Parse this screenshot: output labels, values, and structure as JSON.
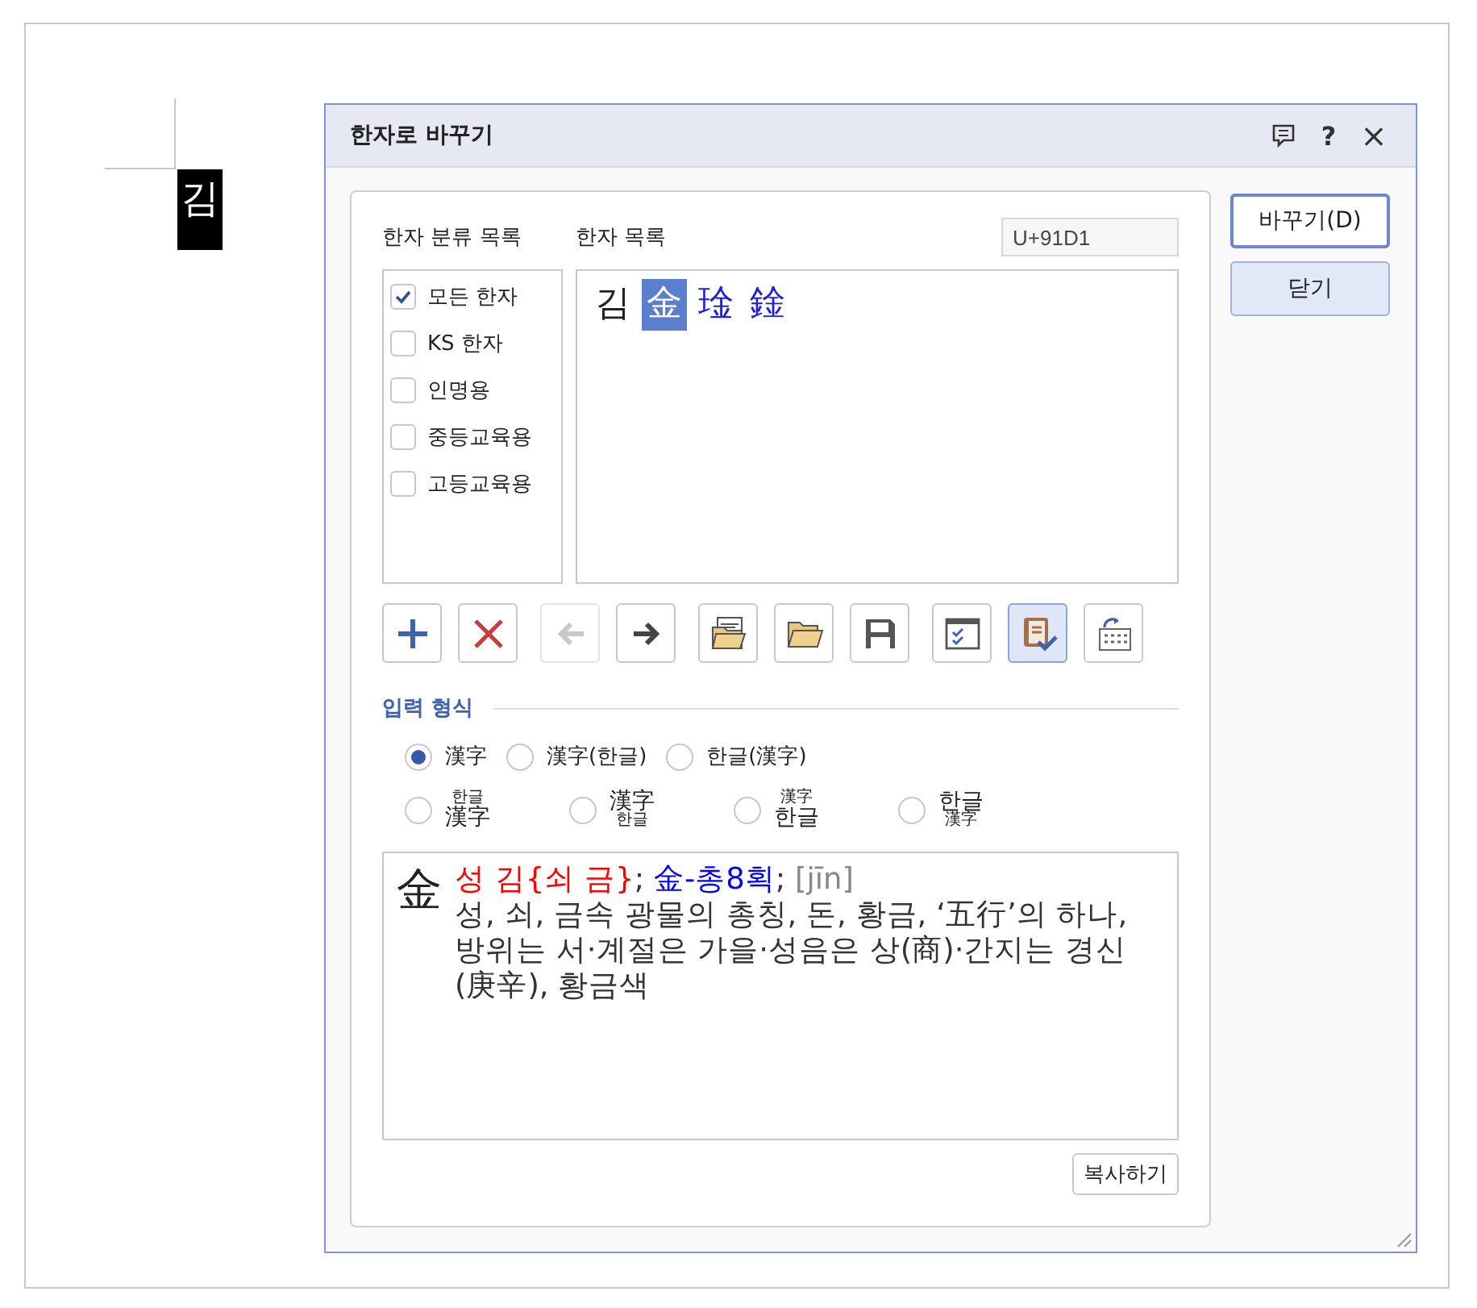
{
  "document": {
    "selected_text": "김"
  },
  "window": {
    "title": "한자로 바꾸기"
  },
  "title_buttons": [
    {
      "kind": "comment"
    },
    {
      "kind": "help",
      "label": "?"
    },
    {
      "kind": "close",
      "label": "×"
    }
  ],
  "category_header": "한자 분류 목록",
  "hanja_header": "한자 목록",
  "code_field": {
    "value": "U+91D1"
  },
  "categories": [
    {
      "label": "모든 한자",
      "checked": true
    },
    {
      "label": "KS 한자",
      "checked": false
    },
    {
      "label": "인명용",
      "checked": false
    },
    {
      "label": "중등교육용",
      "checked": false
    },
    {
      "label": "고등교육용",
      "checked": false
    }
  ],
  "hanja_list": [
    {
      "text": "김",
      "kind": "hangul",
      "selected": false
    },
    {
      "text": "金",
      "kind": "hanja",
      "selected": true
    },
    {
      "text": "琻",
      "kind": "hanja",
      "selected": false
    },
    {
      "text": "鍂",
      "kind": "hanja",
      "selected": false
    }
  ],
  "tools": [
    {
      "kind": "add",
      "disabled": false,
      "selected": false
    },
    {
      "kind": "delete",
      "disabled": false,
      "selected": false
    },
    {
      "kind": "back",
      "disabled": true,
      "selected": false
    },
    {
      "kind": "forward",
      "disabled": false,
      "selected": false
    },
    {
      "kind": "open-txt",
      "disabled": false,
      "selected": false
    },
    {
      "kind": "open",
      "disabled": false,
      "selected": false
    },
    {
      "kind": "save",
      "disabled": false,
      "selected": false
    },
    {
      "kind": "checklist",
      "disabled": false,
      "selected": false
    },
    {
      "kind": "notebook",
      "disabled": false,
      "selected": true
    },
    {
      "kind": "grid",
      "disabled": false,
      "selected": false
    }
  ],
  "input_format": {
    "title": "입력 형식",
    "rows": [
      [
        {
          "kind": "inline",
          "label": "漢字",
          "selected": true
        },
        {
          "kind": "inline",
          "label": "漢字(한글)",
          "selected": false
        },
        {
          "kind": "inline",
          "label": "한글(漢字)",
          "selected": false
        }
      ],
      [
        {
          "kind": "stacked",
          "lines": [
            {
              "text": "한글",
              "kind": "small"
            },
            {
              "text": "漢字",
              "kind": "large"
            }
          ],
          "selected": false
        },
        {
          "kind": "stacked",
          "lines": [
            {
              "text": "漢字",
              "kind": "large"
            },
            {
              "text": "한글",
              "kind": "small"
            }
          ],
          "selected": false
        },
        {
          "kind": "stacked",
          "lines": [
            {
              "text": "漢字",
              "kind": "small"
            },
            {
              "text": "한글",
              "kind": "large"
            }
          ],
          "selected": false
        },
        {
          "kind": "stacked",
          "lines": [
            {
              "text": "한글",
              "kind": "large"
            },
            {
              "text": "漢字",
              "kind": "small"
            }
          ],
          "selected": false
        }
      ]
    ]
  },
  "description": {
    "character": "金",
    "heading": [
      {
        "text": "성 김{쇠 금}",
        "color": "#ff0000"
      },
      {
        "text": "; ",
        "color": "#333333"
      },
      {
        "text": "金-총8획",
        "color": "#0000ff"
      },
      {
        "text": "; ",
        "color": "#333333"
      },
      {
        "text": "[jīn]",
        "color": "#888888"
      }
    ],
    "body": "성, 쇠, 금속 광물의 총칭, 돈, 황금, ‘五行’의 하나, 방위는 서·계절은 가을·성음은 상(商)·간지는 경신(庚辛), 황금색"
  },
  "copy_button": "복사하기",
  "buttons": [
    {
      "label": "바꾸기(D)",
      "kind": "default"
    },
    {
      "label": "닫기",
      "kind": "normal"
    }
  ]
}
